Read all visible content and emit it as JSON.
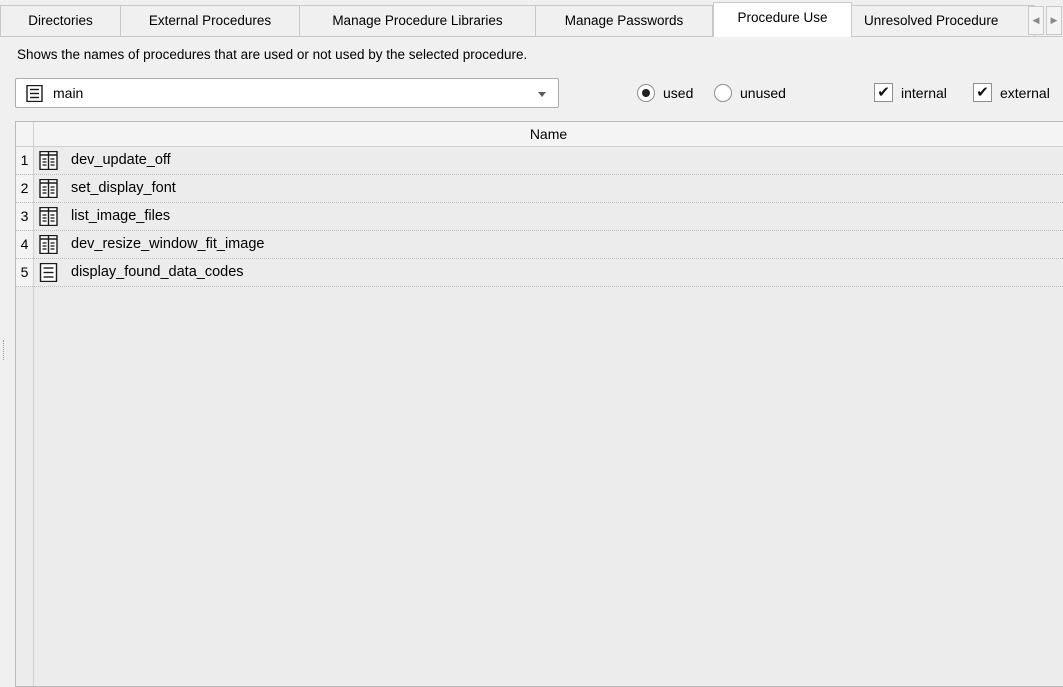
{
  "tabs": [
    {
      "label": "Directories"
    },
    {
      "label": "External Procedures"
    },
    {
      "label": "Manage Procedure Libraries"
    },
    {
      "label": "Manage Passwords"
    },
    {
      "label": "Procedure Use",
      "active": true
    },
    {
      "label": "Unresolved Procedure"
    }
  ],
  "description": "Shows the names of procedures that are used or not used by the selected procedure.",
  "procedure_select": {
    "value": "main",
    "icon": "procedure-icon"
  },
  "usage": {
    "used_label": "used",
    "unused_label": "unused",
    "selected": "used"
  },
  "filters": {
    "internal_label": "internal",
    "internal_checked": true,
    "external_label": "external",
    "external_checked": true
  },
  "check_mark": "✔",
  "table": {
    "column_header": "Name",
    "rows": [
      {
        "num": "1",
        "name": "dev_update_off",
        "icon": "procedure-external-icon"
      },
      {
        "num": "2",
        "name": "set_display_font",
        "icon": "procedure-external-icon"
      },
      {
        "num": "3",
        "name": "list_image_files",
        "icon": "procedure-external-icon"
      },
      {
        "num": "4",
        "name": "dev_resize_window_fit_image",
        "icon": "procedure-external-icon"
      },
      {
        "num": "5",
        "name": "display_found_data_codes",
        "icon": "procedure-local-icon"
      }
    ]
  }
}
